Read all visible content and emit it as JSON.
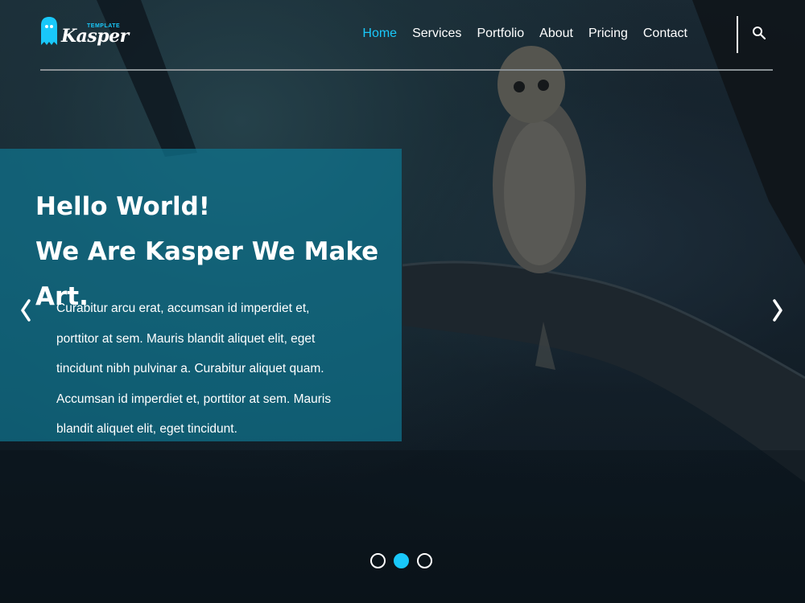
{
  "brand": {
    "tag": "TEMPLATE",
    "name": "Kasper",
    "accent_color": "#19c8fa"
  },
  "nav": {
    "items": [
      {
        "label": "Home",
        "active": true
      },
      {
        "label": "Services",
        "active": false
      },
      {
        "label": "Portfolio",
        "active": false
      },
      {
        "label": "About",
        "active": false
      },
      {
        "label": "Pricing",
        "active": false
      },
      {
        "label": "Contact",
        "active": false
      }
    ],
    "search_icon": "search-icon"
  },
  "hero": {
    "title_line1": "Hello World!",
    "title_line2": "We Are Kasper We Make Art.",
    "body": "Curabitur arcu erat, accumsan id imperdiet et, porttitor at sem. Mauris blandit aliquet elit, eget tincidunt nibh pulvinar a. Curabitur aliquet quam. Accumsan id imperdiet et, porttitor at sem. Mauris blandit aliquet elit, eget tincidunt.",
    "prev_icon": "chevron-left-icon",
    "next_icon": "chevron-right-icon",
    "panel_color": "#0f748f"
  },
  "slider": {
    "bullets": [
      {
        "active": false
      },
      {
        "active": true
      },
      {
        "active": false
      }
    ]
  }
}
